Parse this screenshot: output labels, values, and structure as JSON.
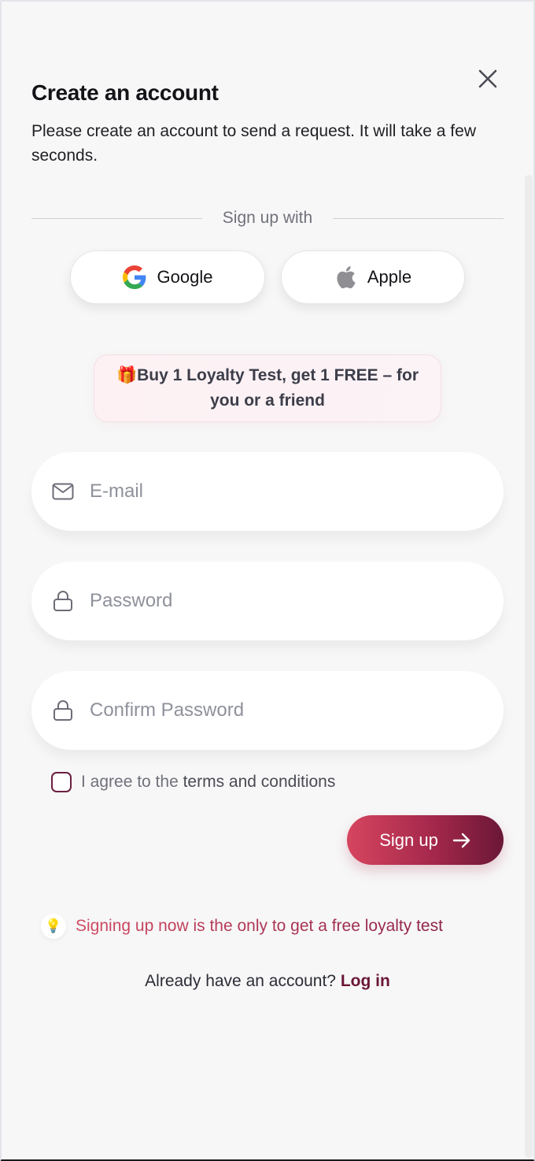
{
  "modal": {
    "title": "Create an account",
    "subtitle": "Please create an account to send a request. It will take a few seconds."
  },
  "social": {
    "divider_label": "Sign up with",
    "google_label": "Google",
    "apple_label": "Apple"
  },
  "promo": {
    "emoji": "🎁",
    "text": "Buy 1 Loyalty Test, get 1 FREE – for you or a friend"
  },
  "form": {
    "email_placeholder": "E-mail",
    "password_placeholder": "Password",
    "confirm_placeholder": "Confirm Password",
    "agree_prefix": "I agree to the ",
    "terms_label": "terms and conditions",
    "agree_checked": false,
    "submit_label": "Sign up"
  },
  "hint": {
    "emoji": "💡",
    "text": "Signing up now is the only to get a free loyalty test"
  },
  "login": {
    "prompt": "Already have an account?",
    "link_label": "Log in"
  },
  "colors": {
    "accent": "#6b1737",
    "accent_light": "#d6455f",
    "background": "#f7f7f7"
  },
  "icons": [
    "close-icon",
    "google-icon",
    "apple-icon",
    "mail-icon",
    "lock-icon",
    "arrow-right-icon",
    "lightbulb-icon",
    "gift-icon"
  ]
}
